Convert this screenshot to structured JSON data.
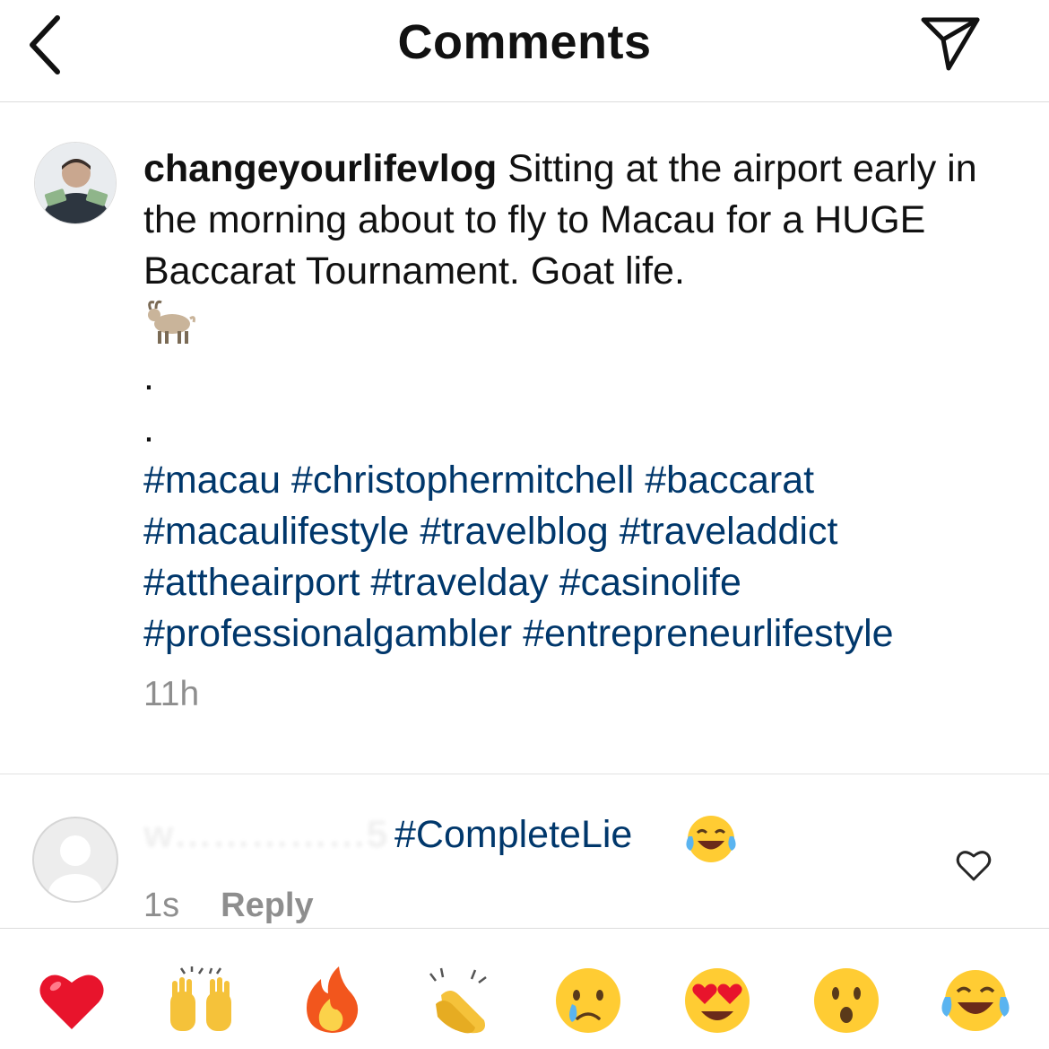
{
  "header": {
    "title": "Comments",
    "back_icon": "chevron-left-icon",
    "share_icon": "paper-plane-icon"
  },
  "post": {
    "username": "changeyourlifevlog",
    "caption_text": " Sitting at the airport early in the morning about to fly to Macau for a HUGE Baccarat Tournament. Goat life.",
    "emoji": "goat",
    "dot1": ".",
    "dot2": ".",
    "hashtags": "#macau #christophermitchell #baccarat #macaulifestyle #travelblog #traveladdict #attheairport #travelday #casinolife #professionalgambler #entrepreneurlifestyle",
    "timestamp": "11h"
  },
  "comment": {
    "username_obscured": "w……………5",
    "text": "#CompleteLie",
    "emoji": "face-with-tears-of-joy",
    "time": "1s",
    "reply_label": "Reply",
    "like_icon": "heart-outline-icon"
  },
  "reaction_bar": [
    "red-heart",
    "raising-hands",
    "fire",
    "clapping-hands",
    "crying-face",
    "heart-eyes",
    "hushed-face",
    "tears-of-joy"
  ],
  "colors": {
    "hashtag_blue": "#00376b",
    "muted_gray": "#8e8e8e",
    "divider": "#dcdcdc"
  }
}
